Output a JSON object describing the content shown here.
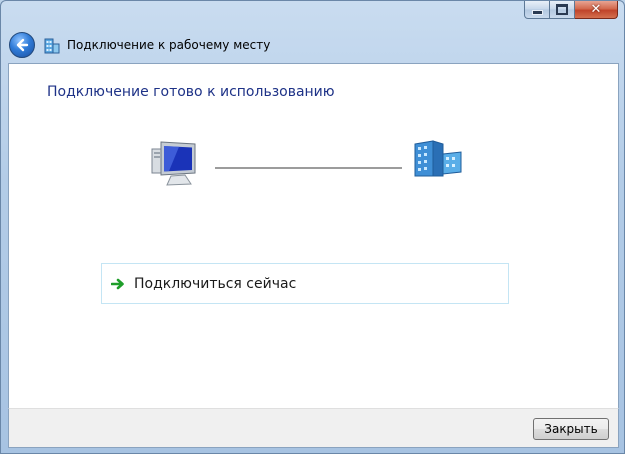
{
  "window": {
    "title": "Подключение к рабочему месту",
    "caption": {
      "minimize_icon": "minimize-icon",
      "maximize_icon": "maximize-icon",
      "close_glyph": "✕"
    },
    "back_icon": "back-arrow-icon",
    "app_icon": "workplace-network-icon"
  },
  "main": {
    "heading": "Подключение готово к использованию",
    "diagram": {
      "left_icon": "computer-icon",
      "right_icon": "corporate-building-icon"
    },
    "connect_option": {
      "label": "Подключиться сейчас",
      "icon": "green-arrow-icon"
    }
  },
  "footer": {
    "close_label": "Закрыть"
  },
  "colors": {
    "heading": "#1e3287",
    "frame": "#b3cce7",
    "close_caption": "#c0432a",
    "connect_border": "#c4e5f4",
    "arrow_green": "#1f9e2a"
  }
}
